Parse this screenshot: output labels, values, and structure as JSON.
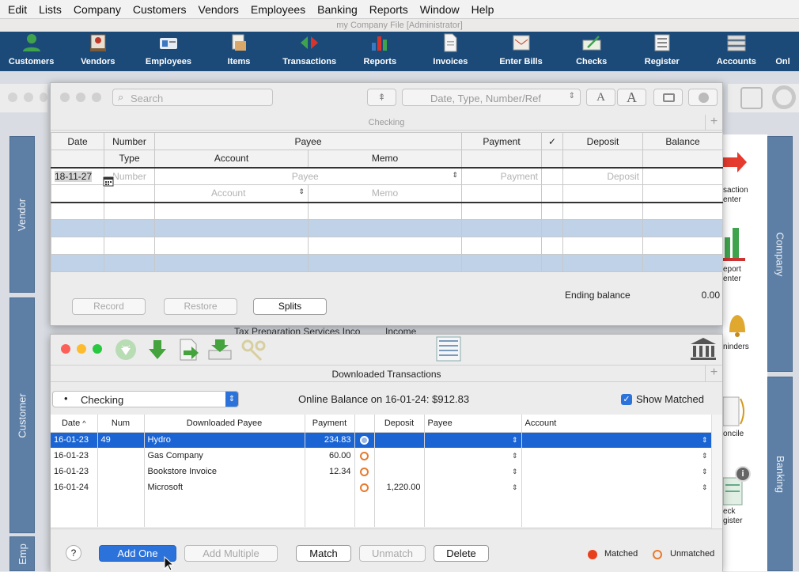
{
  "menu": [
    "Edit",
    "Lists",
    "Company",
    "Customers",
    "Vendors",
    "Employees",
    "Banking",
    "Reports",
    "Window",
    "Help"
  ],
  "window_title": "my Company File [Administrator]",
  "toolbar": [
    {
      "label": "Customers",
      "icon": "customers-icon"
    },
    {
      "label": "Vendors",
      "icon": "vendors-icon"
    },
    {
      "label": "Employees",
      "icon": "employees-icon"
    },
    {
      "label": "Items",
      "icon": "items-icon"
    },
    {
      "label": "Transactions",
      "icon": "transactions-icon"
    },
    {
      "label": "Reports",
      "icon": "reports-icon"
    },
    {
      "label": "Invoices",
      "icon": "invoices-icon"
    },
    {
      "label": "Enter Bills",
      "icon": "enter-bills-icon"
    },
    {
      "label": "Checks",
      "icon": "checks-icon"
    },
    {
      "label": "Register",
      "icon": "register-icon"
    },
    {
      "label": "Accounts",
      "icon": "accounts-icon"
    },
    {
      "label": "Onl",
      "icon": "online-icon"
    }
  ],
  "sidetabs": {
    "vendor": "Vendor",
    "customer": "Customer",
    "emp": "Emp",
    "company": "Company",
    "banking": "Banking"
  },
  "home_icons": {
    "transaction_center": "saction\nenter",
    "report_center": "eport\nenter",
    "reminders": "ninders",
    "reconcile": "oncile",
    "check_register": "eck\ngister"
  },
  "background_text": {
    "vendor": "Tax Preparation Services Inco",
    "type": "Income"
  },
  "register": {
    "search_placeholder": "Search",
    "filter_placeholder": "Date, Type, Number/Ref",
    "title": "Checking",
    "headers1": [
      "Date",
      "Number",
      "Payee",
      "Payment",
      "✓",
      "Deposit",
      "Balance"
    ],
    "headers2": [
      "Type",
      "Account",
      "Memo"
    ],
    "entry": {
      "date": "18-11-27",
      "number": "Number",
      "payee": "Payee",
      "payment": "Payment",
      "deposit": "Deposit",
      "account": "Account",
      "memo": "Memo"
    },
    "buttons": {
      "record": "Record",
      "restore": "Restore",
      "splits": "Splits"
    },
    "ending_label": "Ending balance",
    "ending_value": "0.00"
  },
  "downloaded": {
    "title": "Downloaded Transactions",
    "account": "Checking",
    "online_balance": "Online Balance on 16-01-24: $912.83",
    "show_matched": "Show Matched",
    "headers": [
      "Date",
      "Num",
      "Downloaded Payee",
      "Payment",
      "",
      "Deposit",
      "Payee",
      "Account"
    ],
    "sort_indicator": "^",
    "rows": [
      {
        "date": "16-01-23",
        "num": "49",
        "payee": "Hydro",
        "payment": "234.83",
        "deposit": ""
      },
      {
        "date": "16-01-23",
        "num": "",
        "payee": "Gas Company",
        "payment": "60.00",
        "deposit": ""
      },
      {
        "date": "16-01-23",
        "num": "",
        "payee": "Bookstore Invoice",
        "payment": "12.34",
        "deposit": ""
      },
      {
        "date": "16-01-24",
        "num": "",
        "payee": "Microsoft",
        "payment": "",
        "deposit": "1,220.00"
      }
    ],
    "buttons": {
      "help": "?",
      "add_one": "Add One",
      "add_multiple": "Add Multiple",
      "match": "Match",
      "unmatch": "Unmatch",
      "delete": "Delete"
    },
    "legend": {
      "matched": "Matched",
      "unmatched": "Unmatched"
    }
  },
  "colors": {
    "toolbar": "#1c4a78",
    "selection": "#1a64d4",
    "matched": "#e8401c",
    "unmatched": "#e87a2e",
    "sidetab": "#5d7fa6"
  }
}
